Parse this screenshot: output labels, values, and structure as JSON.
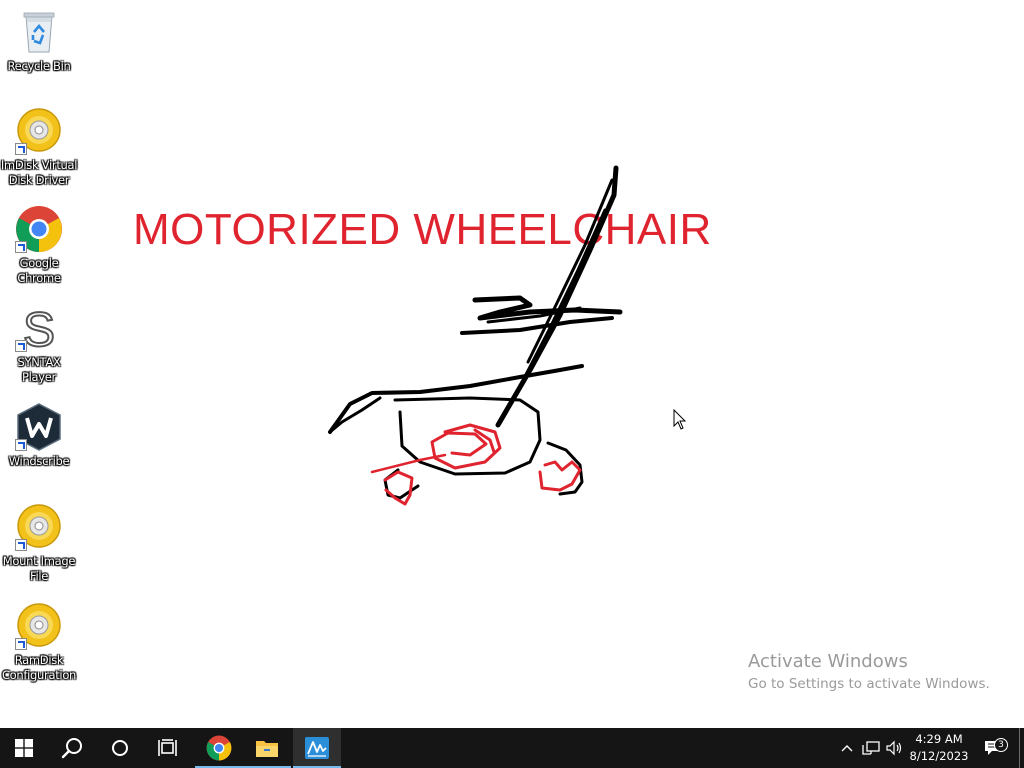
{
  "desktop": {
    "icons": [
      {
        "label": "Recycle Bin",
        "icon": "recycle-bin-icon"
      },
      {
        "label": "ImDisk Virtual Disk Driver",
        "icon": "disc-icon"
      },
      {
        "label": "Google Chrome",
        "icon": "chrome-icon"
      },
      {
        "label": "SYNTAX Player",
        "icon": "syntax-s-icon"
      },
      {
        "label": "Windscribe",
        "icon": "windscribe-icon"
      },
      {
        "label": "Mount Image File",
        "icon": "disc-icon"
      },
      {
        "label": "RamDisk Configuration",
        "icon": "disc-icon"
      }
    ],
    "drawing_title": "MOTORIZED WHEELCHAIR",
    "activation": {
      "line1": "Activate Windows",
      "line2": "Go to Settings to activate Windows."
    }
  },
  "taskbar": {
    "buttons": [
      {
        "name": "start",
        "icon": "windows-logo-icon"
      },
      {
        "name": "search",
        "icon": "search-icon"
      },
      {
        "name": "cortana",
        "icon": "circle-icon"
      },
      {
        "name": "task-view",
        "icon": "task-view-icon"
      },
      {
        "name": "chrome",
        "icon": "chrome-icon"
      },
      {
        "name": "file-explorer",
        "icon": "folder-icon"
      },
      {
        "name": "active-app",
        "icon": "signature-app-icon"
      }
    ],
    "tray": {
      "time": "4:29 AM",
      "date": "8/12/2023",
      "notification_count": "3"
    }
  },
  "colors": {
    "taskbar": "#151515",
    "title_red": "#e0242f",
    "active_underline": "#76b9ed"
  }
}
